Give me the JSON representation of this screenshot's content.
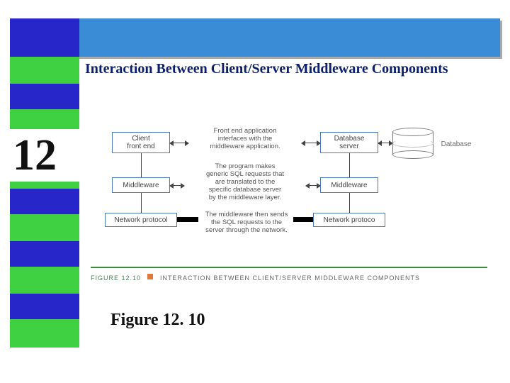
{
  "slide": {
    "chapter_number": "12",
    "title": "Interaction Between Client/Server Middleware Components",
    "figure_label": "Figure 12. 10"
  },
  "diagram": {
    "boxes": {
      "client_front_end": "Client\nfront end",
      "database_server": "Database\nserver",
      "middleware_left": "Middleware",
      "middleware_right": "Middleware",
      "net_proto_left": "Network protocol",
      "net_proto_right": "Network protoco"
    },
    "notes": {
      "top": "Front end application\ninterfaces with the\nmiddleware application.",
      "mid": "The program makes\ngeneric SQL requests that\nare translated to the\nspecific database server\nby the middleware layer.",
      "bot": "The middleware then sends\nthe SQL requests to the\nserver through the network."
    },
    "database_label": "Database",
    "caption_small": {
      "figure": "FIGURE 12.10",
      "text": "INTERACTION BETWEEN CLIENT/SERVER MIDDLEWARE COMPONENTS"
    }
  }
}
